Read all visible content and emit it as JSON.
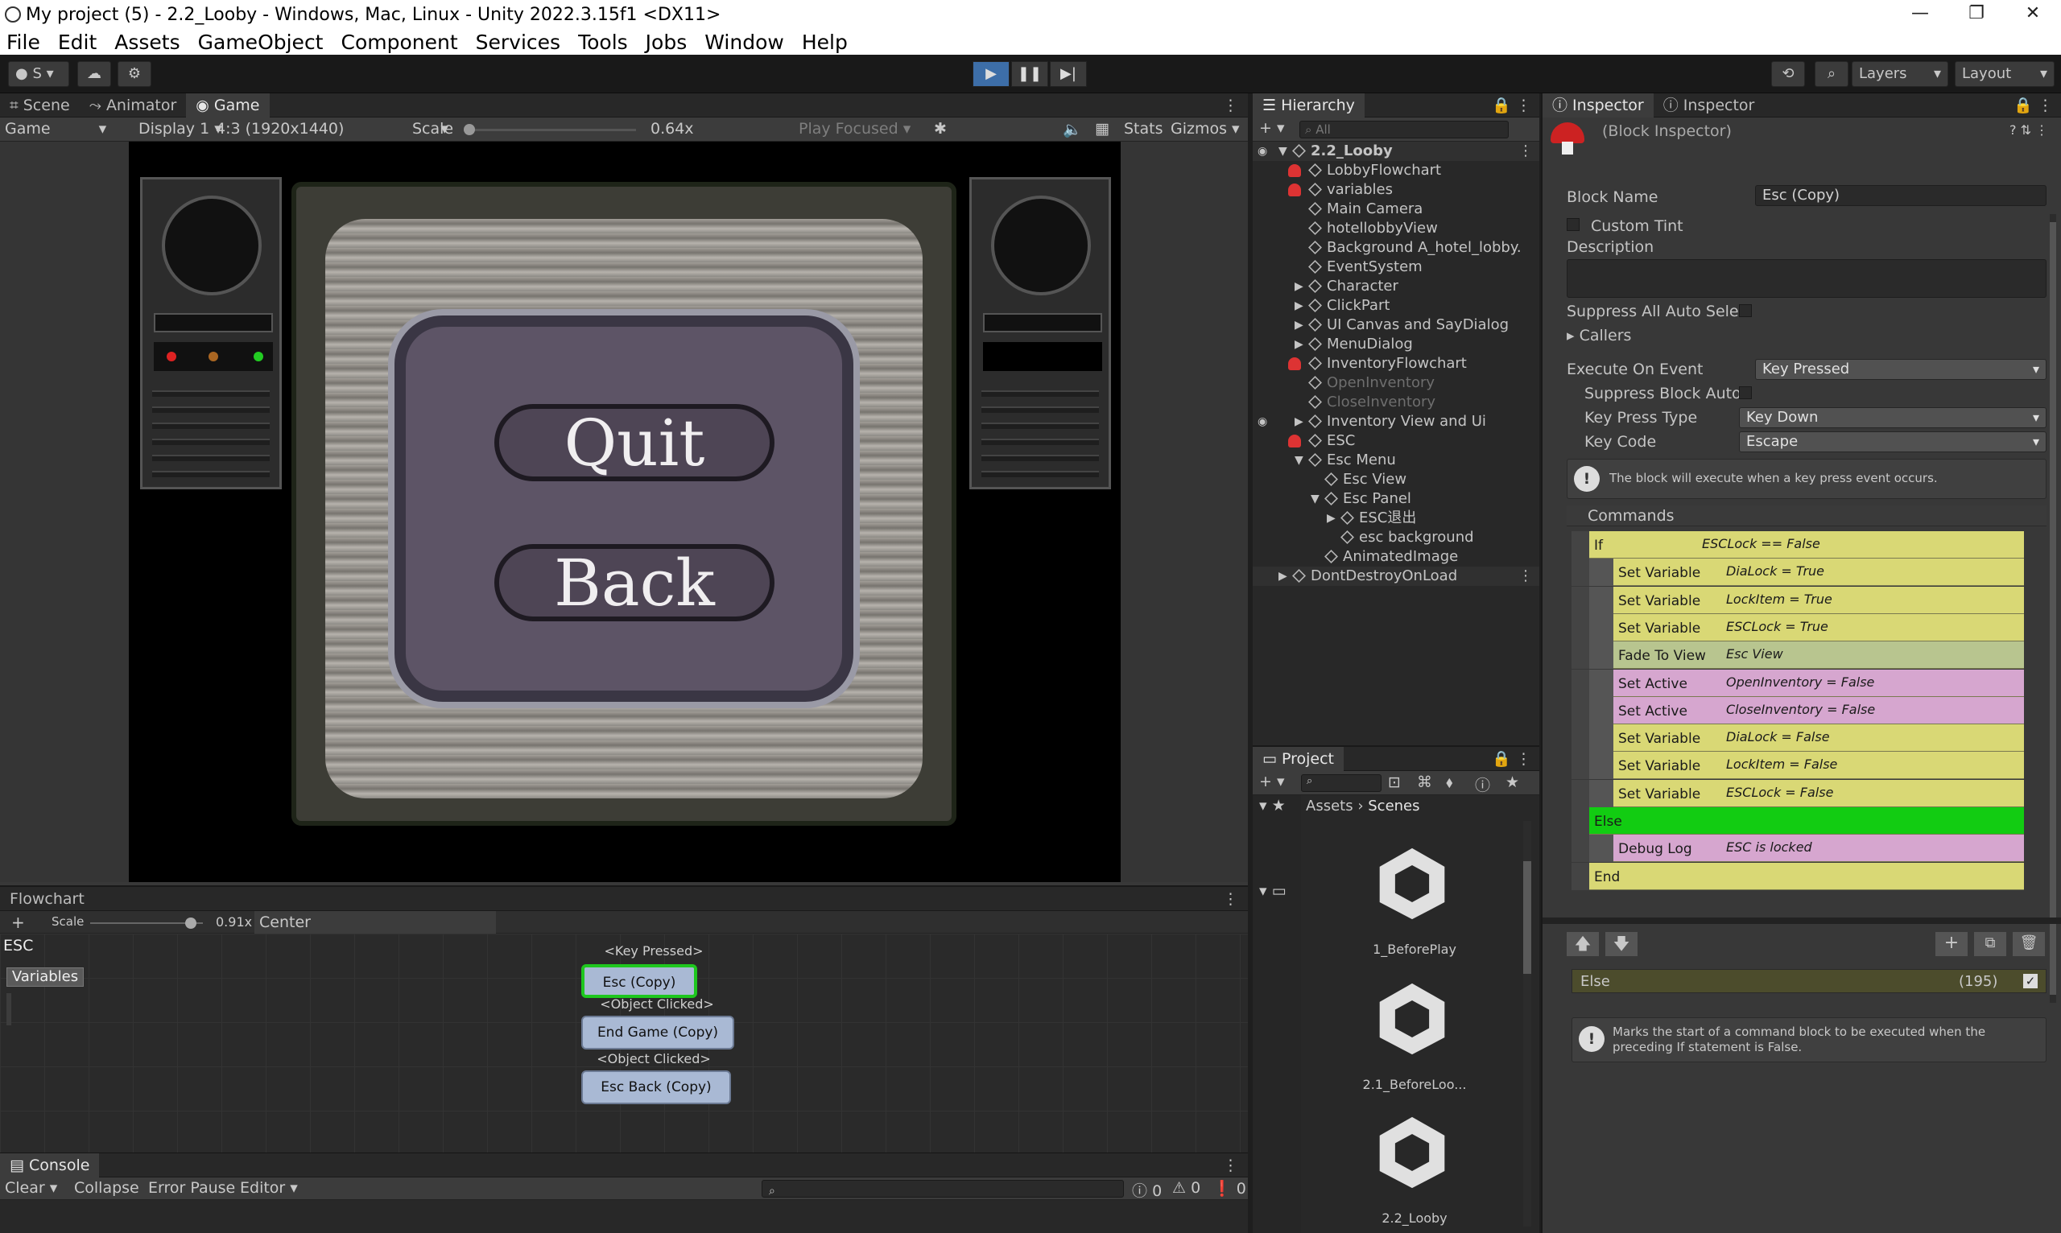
{
  "window": {
    "title": "My project (5) - 2.2_Looby - Windows, Mac, Linux - Unity 2022.3.15f1 <DX11>",
    "controls": [
      "—",
      "❐",
      "✕"
    ]
  },
  "menu": [
    "File",
    "Edit",
    "Assets",
    "GameObject",
    "Component",
    "Services",
    "Tools",
    "Jobs",
    "Window",
    "Help"
  ],
  "toolbar": {
    "account": "S",
    "layers": "Layers",
    "layout": "Layout"
  },
  "game_panel": {
    "tabs": [
      "Scene",
      "Animator",
      "Game"
    ],
    "mode": "Game",
    "display": "Display 1",
    "aspect": "4:3 (1920x1440)",
    "scale_label": "Scale",
    "scale_value": "0.64x",
    "play_focused": "Play Focused",
    "stats": "Stats",
    "gizmos": "Gizmos",
    "game_buttons": [
      "Quit",
      "Back"
    ]
  },
  "flowchart": {
    "title": "Flowchart",
    "scale_label": "Scale",
    "scale_value": "0.91x",
    "center": "Center",
    "name": "ESC",
    "variables_button": "Variables",
    "nodes": [
      {
        "event": "<Key Pressed>",
        "label": "Esc (Copy)"
      },
      {
        "event": "<Object Clicked>",
        "label": "End Game (Copy)"
      },
      {
        "event": "<Object Clicked>",
        "label": "Esc Back (Copy)"
      }
    ]
  },
  "console": {
    "title": "Console",
    "clear": "Clear",
    "collapse": "Collapse",
    "error_pause": "Error Pause",
    "editor": "Editor",
    "counts": [
      "0",
      "0",
      "0"
    ]
  },
  "hierarchy": {
    "title": "Hierarchy",
    "search_placeholder": "All",
    "items": [
      {
        "label": "2.2_Looby",
        "indent": 0,
        "bold": true
      },
      {
        "label": "LobbyFlowchart",
        "indent": 1
      },
      {
        "label": "variables",
        "indent": 1
      },
      {
        "label": "Main Camera",
        "indent": 1
      },
      {
        "label": "hotellobbyView",
        "indent": 1
      },
      {
        "label": "Background A_hotel_lobby.",
        "indent": 1
      },
      {
        "label": "EventSystem",
        "indent": 1
      },
      {
        "label": "Character",
        "indent": 1
      },
      {
        "label": "ClickPart",
        "indent": 1
      },
      {
        "label": "UI Canvas and SayDialog",
        "indent": 1
      },
      {
        "label": "MenuDialog",
        "indent": 1
      },
      {
        "label": "InventoryFlowchart",
        "indent": 1
      },
      {
        "label": "OpenInventory",
        "indent": 1,
        "dim": true
      },
      {
        "label": "CloseInventory",
        "indent": 1,
        "dim": true
      },
      {
        "label": "Inventory View and Ui",
        "indent": 1
      },
      {
        "label": "ESC",
        "indent": 1
      },
      {
        "label": "Esc Menu",
        "indent": 1
      },
      {
        "label": "Esc View",
        "indent": 2
      },
      {
        "label": "Esc Panel",
        "indent": 2
      },
      {
        "label": "ESC退出",
        "indent": 3
      },
      {
        "label": "esc background",
        "indent": 3
      },
      {
        "label": "AnimatedImage",
        "indent": 2
      },
      {
        "label": "DontDestroyOnLoad",
        "indent": 0
      }
    ]
  },
  "project": {
    "title": "Project",
    "breadcrumb_root": "Assets",
    "breadcrumb_current": "Scenes",
    "assets": [
      "1_BeforePlay",
      "2.1_BeforeLoo...",
      "2.2_Looby"
    ]
  },
  "inspector": {
    "tabs": [
      "Inspector",
      "Inspector"
    ],
    "header": "(Block Inspector)",
    "block_name_label": "Block Name",
    "block_name_value": "Esc (Copy)",
    "custom_tint": "Custom Tint",
    "description": "Description",
    "suppress_all": "Suppress All Auto Selec",
    "callers": "Callers",
    "execute_on_event_label": "Execute On Event",
    "execute_on_event_value": "Key Pressed",
    "suppress_block": "Suppress Block Auto",
    "key_press_type_label": "Key Press Type",
    "key_press_type_value": "Key Down",
    "key_code_label": "Key Code",
    "key_code_value": "Escape",
    "info": "The block will execute when a key press event occurs.",
    "commands_title": "Commands",
    "commands": [
      {
        "name": "If",
        "args": "ESCLock == False",
        "color": "yellow",
        "level": 0
      },
      {
        "name": "Set Variable",
        "args": "DiaLock = True",
        "color": "yellow",
        "level": 1
      },
      {
        "name": "Set Variable",
        "args": "LockItem = True",
        "color": "yellow",
        "level": 1
      },
      {
        "name": "Set Variable",
        "args": "ESCLock = True",
        "color": "yellow",
        "level": 1
      },
      {
        "name": "Fade To View",
        "args": "Esc View",
        "color": "gr",
        "level": 1
      },
      {
        "name": "Set Active",
        "args": "OpenInventory = False",
        "color": "pink",
        "level": 1
      },
      {
        "name": "Set Active",
        "args": "CloseInventory = False",
        "color": "pink",
        "level": 1
      },
      {
        "name": "Set Variable",
        "args": "DiaLock = False",
        "color": "yellow",
        "level": 1
      },
      {
        "name": "Set Variable",
        "args": "LockItem = False",
        "color": "yellow",
        "level": 1
      },
      {
        "name": "Set Variable",
        "args": "ESCLock = False",
        "color": "yellow",
        "level": 1
      },
      {
        "name": "Else",
        "args": "",
        "color": "green",
        "level": 0
      },
      {
        "name": "Debug Log",
        "args": "ESC is locked",
        "color": "pink",
        "level": 1
      },
      {
        "name": "End",
        "args": "",
        "color": "yellow",
        "level": 0
      }
    ],
    "selected_command": "Else",
    "selected_command_id": "(195)",
    "selected_info": "Marks the start of a command block to be executed when the preceding If statement is False."
  }
}
